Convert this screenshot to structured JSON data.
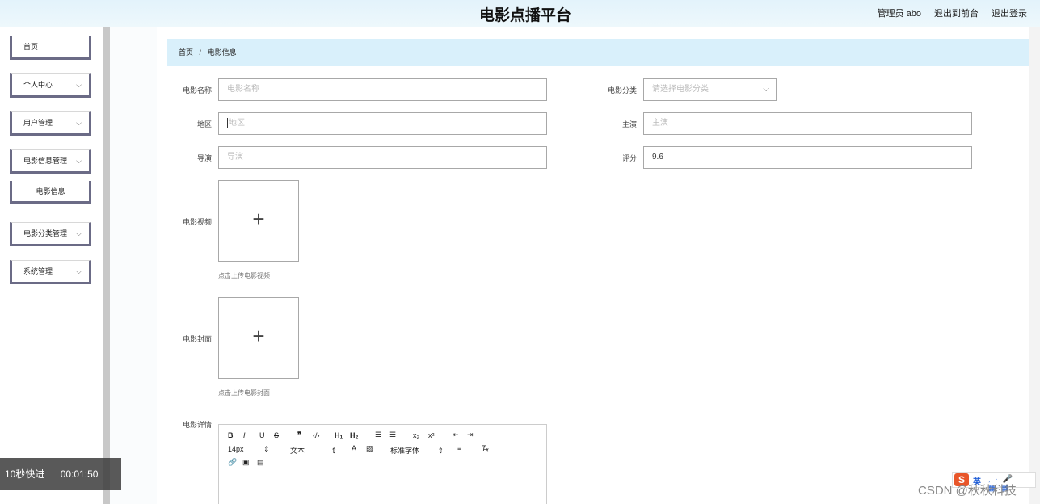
{
  "header": {
    "title": "电影点播平台",
    "user": "管理员 abo",
    "front_link": "退出到前台",
    "logout_link": "退出登录"
  },
  "sidebar": {
    "items": [
      {
        "label": "首页"
      },
      {
        "label": "个人中心"
      },
      {
        "label": "用户管理"
      },
      {
        "label": "电影信息管理"
      },
      {
        "label": "电影信息"
      },
      {
        "label": "电影分类管理"
      },
      {
        "label": "系统管理"
      }
    ]
  },
  "breadcrumb": {
    "home": "首页",
    "sep": "/",
    "current": "电影信息"
  },
  "form": {
    "name_label": "电影名称",
    "name_placeholder": "电影名称",
    "category_label": "电影分类",
    "category_placeholder": "请选择电影分类",
    "region_label": "地区",
    "region_placeholder": "地区",
    "actor_label": "主演",
    "actor_placeholder": "主演",
    "director_label": "导演",
    "director_placeholder": "导演",
    "rating_label": "评分",
    "rating_value": "9.6",
    "video_label": "电影视频",
    "video_hint": "点击上传电影视频",
    "cover_label": "电影封面",
    "cover_hint": "点击上传电影封面",
    "detail_label": "电影详情"
  },
  "editor": {
    "font_size": "14px",
    "block_type": "文本",
    "font_family": "标准字体"
  },
  "overlay": {
    "skip": "10秒快进",
    "time": "00:01:50"
  },
  "ime": {
    "logo": "S",
    "lang": "英"
  },
  "watermark": "CSDN @秋秋科技"
}
